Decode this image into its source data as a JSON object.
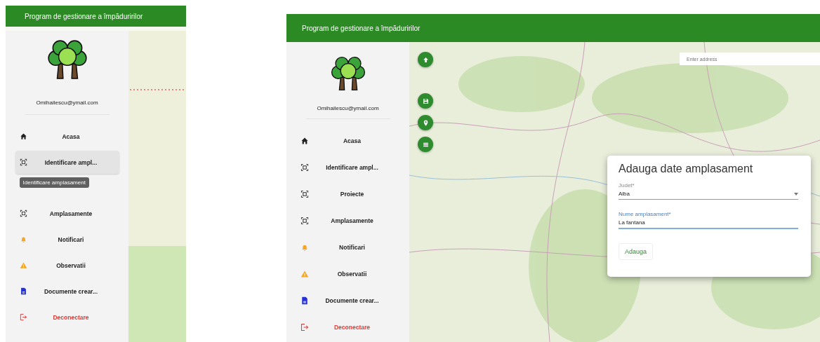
{
  "screens": [
    {
      "header": {
        "title": "Program de gestionare a împăduririlor"
      },
      "sidebar": {
        "email": "Omihailescu@ymail.com",
        "items": [
          {
            "label": "Acasa",
            "kind": "home",
            "selected": false
          },
          {
            "label": "Identificare ampl...",
            "kind": "frame",
            "selected": true,
            "tooltip": "Identificare amplasament"
          },
          {
            "label": "Amplasamente",
            "kind": "frame",
            "selected": false
          },
          {
            "label": "Notificari",
            "kind": "bell",
            "selected": false
          },
          {
            "label": "Observatii",
            "kind": "warning",
            "selected": false
          },
          {
            "label": "Documente crear...",
            "kind": "document",
            "selected": false
          },
          {
            "label": "Deconectare",
            "kind": "logout",
            "selected": false
          }
        ]
      },
      "map": {
        "kind": "zoomed"
      }
    },
    {
      "header": {
        "title": "Program de gestionare a împăduririlor"
      },
      "sidebar": {
        "email": "Omihailescu@ymail.com",
        "items": [
          {
            "label": "Acasa",
            "kind": "home",
            "selected": false
          },
          {
            "label": "Identificare ampl...",
            "kind": "frame",
            "selected": false
          },
          {
            "label": "Proiecte",
            "kind": "frame",
            "selected": false
          },
          {
            "label": "Amplasamente",
            "kind": "frame",
            "selected": false
          },
          {
            "label": "Notificari",
            "kind": "bell",
            "selected": false
          },
          {
            "label": "Observatii",
            "kind": "warning",
            "selected": false
          },
          {
            "label": "Documente crear...",
            "kind": "document",
            "selected": false
          },
          {
            "label": "Deconectare",
            "kind": "logout",
            "selected": false
          }
        ]
      },
      "map": {
        "kind": "overview",
        "fab_buttons": [
          {
            "kind": "arrow-up"
          },
          {
            "kind": "floppy"
          },
          {
            "kind": "pin"
          },
          {
            "kind": "list"
          }
        ],
        "search": {
          "placeholder": "Enter address"
        },
        "dialog": {
          "title": "Adauga date amplasament",
          "select": {
            "label": "Judet*",
            "value": "Alba"
          },
          "field": {
            "label": "Nume amplasament*",
            "value": "La fantana"
          },
          "button": "Adauga"
        }
      }
    }
  ]
}
